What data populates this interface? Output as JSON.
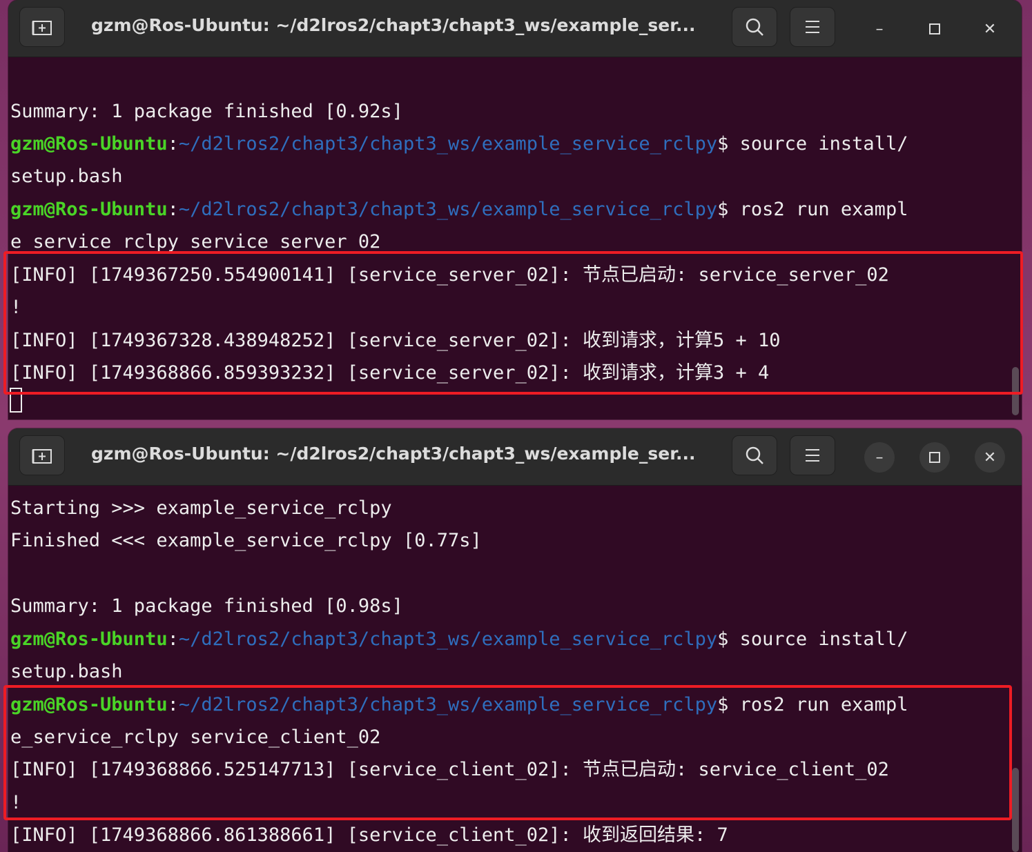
{
  "windows": [
    {
      "title": "gzm@Ros-Ubuntu: ~/d2lros2/chapt3/chapt3_ws/example_ser...",
      "lines": [
        {
          "t": "Summary: 1 package finished [0.92s]"
        },
        {
          "user": "gzm@Ros-Ubuntu",
          "path": "~/d2lros2/chapt3/chapt3_ws/example_service_rclpy",
          "cmd": "$ source install/"
        },
        {
          "t": "setup.bash"
        },
        {
          "user": "gzm@Ros-Ubuntu",
          "path": "~/d2lros2/chapt3/chapt3_ws/example_service_rclpy",
          "cmd": "$ ros2 run exampl"
        },
        {
          "t": "e_service_rclpy service_server_02"
        },
        {
          "t": "[INFO] [1749367250.554900141] [service_server_02]: 节点已启动: service_server_02"
        },
        {
          "t": "!"
        },
        {
          "t": "[INFO] [1749367328.438948252] [service_server_02]: 收到请求，计算5 + 10"
        },
        {
          "t": "[INFO] [1749368866.859393232] [service_server_02]: 收到请求，计算3 + 4"
        }
      ]
    },
    {
      "title": "gzm@Ros-Ubuntu: ~/d2lros2/chapt3/chapt3_ws/example_ser...",
      "lines": [
        {
          "t": "Starting >>> example_service_rclpy"
        },
        {
          "t": "Finished <<< example_service_rclpy [0.77s]"
        },
        {
          "t": ""
        },
        {
          "t": "Summary: 1 package finished [0.98s]"
        },
        {
          "user": "gzm@Ros-Ubuntu",
          "path": "~/d2lros2/chapt3/chapt3_ws/example_service_rclpy",
          "cmd": "$ source install/"
        },
        {
          "t": "setup.bash"
        },
        {
          "user": "gzm@Ros-Ubuntu",
          "path": "~/d2lros2/chapt3/chapt3_ws/example_service_rclpy",
          "cmd": "$ ros2 run exampl"
        },
        {
          "t": "e_service_rclpy service_client_02"
        },
        {
          "t": "[INFO] [1749368866.525147713] [service_client_02]: 节点已启动: service_client_02"
        },
        {
          "t": "!"
        },
        {
          "t": "[INFO] [1749368866.861388661] [service_client_02]: 收到返回结果: 7"
        }
      ]
    }
  ],
  "icons": {
    "new_tab": "new-tab-icon",
    "search": "search-icon",
    "menu": "hamburger-menu-icon",
    "minimize": "minimize-icon",
    "maximize": "maximize-icon",
    "close": "close-icon"
  },
  "colors": {
    "terminal_bg": "#300a24",
    "prompt_user": "#4ad427",
    "prompt_path": "#2f6ebd",
    "text": "#ededed",
    "highlight_box": "#ee1c24"
  }
}
